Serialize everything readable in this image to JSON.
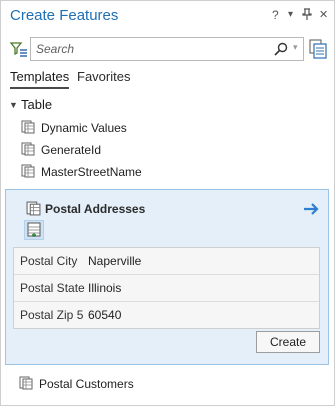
{
  "pane": {
    "title": "Create Features",
    "controls": {
      "help": "?",
      "dropdown": "▾",
      "pin": "⊥",
      "close": "✕"
    }
  },
  "search": {
    "placeholder": "Search"
  },
  "tabs": [
    {
      "label": "Templates",
      "active": true
    },
    {
      "label": "Favorites",
      "active": false
    }
  ],
  "group": {
    "label": "Table",
    "items": [
      {
        "label": "Dynamic Values"
      },
      {
        "label": "GenerateId"
      },
      {
        "label": "MasterStreetName"
      }
    ]
  },
  "selected_template": {
    "label": "Postal Addresses",
    "attributes": [
      {
        "label": "Postal City",
        "value": "Naperville"
      },
      {
        "label": "Postal State",
        "value": "Illinois"
      },
      {
        "label": "Postal Zip 5",
        "value": "60540"
      }
    ],
    "create_label": "Create"
  },
  "bottom_item": {
    "label": "Postal Customers"
  },
  "colors": {
    "accent": "#1f6fb5",
    "selection_bg": "#e4eff9",
    "selection_border": "#9cc4e6"
  }
}
